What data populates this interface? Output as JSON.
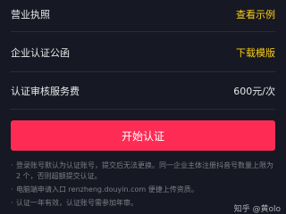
{
  "rows": {
    "license": {
      "label": "营业执照",
      "action": "查看示例"
    },
    "letter": {
      "label": "企业认证公函",
      "action": "下载模版"
    },
    "fee": {
      "label": "认证审核服务费",
      "value": "600元/次"
    }
  },
  "start_button": {
    "label": "开始认证"
  },
  "notes": [
    "登录账号默认为认证账号，提交后无法更换。同一企业主体注册抖音号数量上限为 2 个，否则超额提交认证。",
    "电脑端申请入口 renzheng.douyin.com 便捷上传资质。",
    "认证一年有效，认证账号需参加年审。"
  ],
  "watermark": {
    "text": "知乎 @黄olo"
  },
  "colors": {
    "background": "#161823",
    "accent_yellow": "#face15",
    "button_red": "#fe2c55",
    "text_primary": "#e9e9ea",
    "text_secondary": "#7d7e85"
  }
}
